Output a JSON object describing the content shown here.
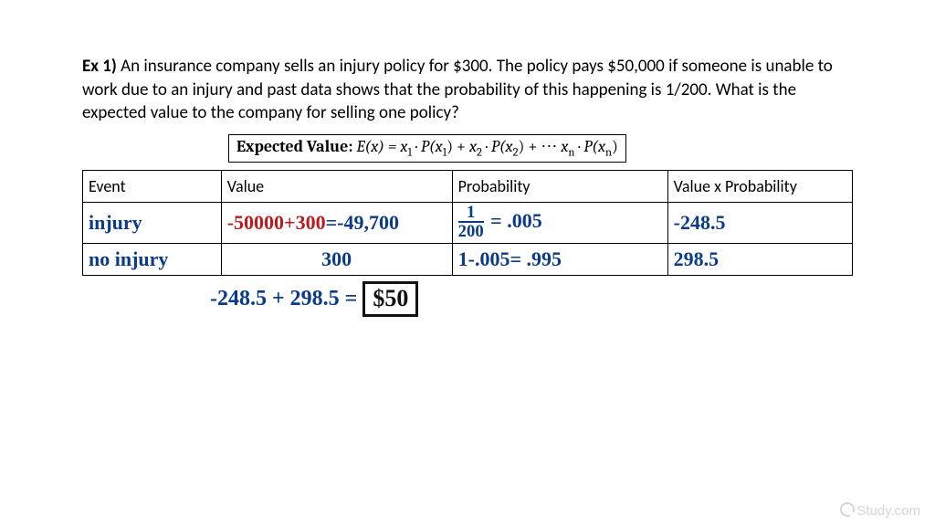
{
  "problem": {
    "label": "Ex 1)",
    "text": "An insurance company sells an injury policy for $300. The policy pays $50,000 if someone is unable to work due to an injury and past data shows that the probability of this happening is 1/200. What is the expected value to the company for selling one policy?"
  },
  "formula": {
    "label": "Expected Value:",
    "expr_parts": {
      "lhs": "E(x) = ",
      "x1": "x",
      "s1": "1",
      "dot": " · ",
      "p": "P(x",
      "cp": ")",
      "plus": " + ",
      "ell": " + ⋯ ",
      "xn": "x",
      "sn": "n"
    }
  },
  "table": {
    "headers": [
      "Event",
      "Value",
      "Probability",
      "Value x Probability"
    ],
    "rows": [
      {
        "event": "injury",
        "value_red": "-50000+300",
        "value_eq": "=",
        "value_result": "-49,700",
        "prob_frac_num": "1",
        "prob_frac_den": "200",
        "prob_eq": "= .005",
        "vp": "-248.5"
      },
      {
        "event": "no injury",
        "value_result": "300",
        "prob_eq": "1-.005= .995",
        "vp": "298.5"
      }
    ]
  },
  "calc": {
    "lhs": "-248.5 + 298.5 =",
    "answer": "$50"
  },
  "watermark": "Study.com",
  "chart_data": {
    "type": "table",
    "title": "Expected value of selling one injury policy",
    "columns": [
      "Event",
      "Value",
      "Probability",
      "Value x Probability"
    ],
    "rows": [
      [
        "injury",
        -49700,
        0.005,
        -248.5
      ],
      [
        "no injury",
        300,
        0.995,
        298.5
      ]
    ],
    "expected_value": 50
  }
}
